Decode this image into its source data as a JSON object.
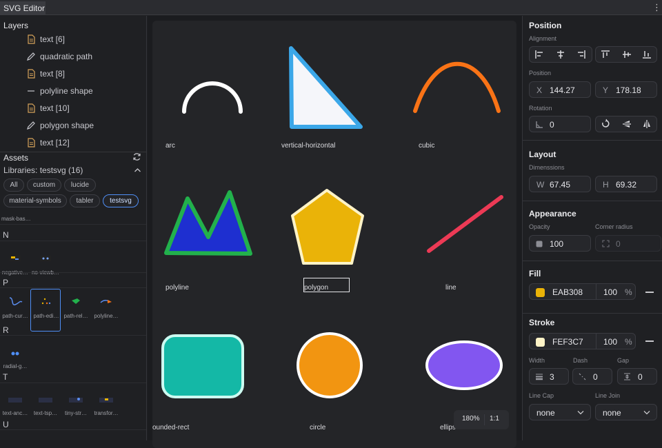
{
  "window": {
    "tab_title": "SVG Editor",
    "menu_icon": "more-vertical-icon"
  },
  "layers": {
    "title": "Layers",
    "items": [
      {
        "label": "text [6]",
        "icon": "text-file-icon"
      },
      {
        "label": "quadratic path",
        "icon": "pen-icon"
      },
      {
        "label": "text [8]",
        "icon": "text-file-icon"
      },
      {
        "label": "polyline shape",
        "icon": "line-icon"
      },
      {
        "label": "text [10]",
        "icon": "text-file-icon"
      },
      {
        "label": "polygon shape",
        "icon": "pen-icon"
      },
      {
        "label": "text [12]",
        "icon": "text-file-icon"
      }
    ]
  },
  "assets": {
    "title": "Assets",
    "library_label": "Libraries: testsvg (16)",
    "filters": [
      "All",
      "custom",
      "lucide",
      "material-symbols",
      "tabler",
      "testsvg"
    ],
    "active_filter": "testsvg",
    "top_item": "mask-bas…",
    "groups": [
      {
        "letter": "N",
        "items": [
          "negative…",
          "no-viewb…"
        ]
      },
      {
        "letter": "P",
        "items": [
          "path-cur…",
          "path-edi…",
          "path-rel…",
          "polyline…"
        ]
      },
      {
        "letter": "R",
        "items": [
          "radial-g…"
        ]
      },
      {
        "letter": "T",
        "items": [
          "text-anc…",
          "text-tsp…",
          "tiny-str…",
          "transfor…"
        ]
      },
      {
        "letter": "U",
        "items": []
      }
    ]
  },
  "canvas": {
    "labels": [
      "arc",
      "vertical-horizontal",
      "cubic",
      "polyline",
      "polygon",
      "line",
      "ounded-rect",
      "circle",
      "ellips"
    ],
    "zoom": "180%",
    "zoom_reset": "1:1",
    "colors": {
      "arc": "#ffffff",
      "vh_stroke": "#3ba7e8",
      "vh_fill": "#f5f6fa",
      "cubic": "#f97316",
      "poly_fill": "#1e2fd0",
      "poly_stroke": "#22b14c",
      "pentagon_fill": "#EAB308",
      "pentagon_stroke": "#FEF3C7",
      "line": "#ec3a55",
      "rect_fill": "#14b8a6",
      "rect_stroke": "#ccfbf1",
      "circle_fill": "#f29511",
      "ellipse_fill": "#8256f0"
    }
  },
  "properties": {
    "position": {
      "title": "Position",
      "alignment_label": "Alignment",
      "position_label": "Position",
      "x_label": "X",
      "x_value": "144.27",
      "y_label": "Y",
      "y_value": "178.18",
      "rotation_label": "Rotation",
      "rotation_value": "0"
    },
    "layout": {
      "title": "Layout",
      "dimensions_label": "Dimenssions",
      "w_label": "W",
      "w_value": "67.45",
      "h_label": "H",
      "h_value": "69.32"
    },
    "appearance": {
      "title": "Appearance",
      "opacity_label": "Opacity",
      "opacity_value": "100",
      "radius_label": "Corner radius",
      "radius_value": "0"
    },
    "fill": {
      "title": "Fill",
      "color": "EAB308",
      "swatch": "#EAB308",
      "opacity": "100",
      "unit": "%"
    },
    "stroke": {
      "title": "Stroke",
      "color": "FEF3C7",
      "swatch": "#FEF3C7",
      "opacity": "100",
      "unit": "%",
      "width_label": "Width",
      "width_value": "3",
      "dash_label": "Dash",
      "dash_value": "0",
      "gap_label": "Gap",
      "gap_value": "0",
      "linecap_label": "Line Cap",
      "linecap_value": "none",
      "linejoin_label": "Line Join",
      "linejoin_value": "none"
    }
  }
}
